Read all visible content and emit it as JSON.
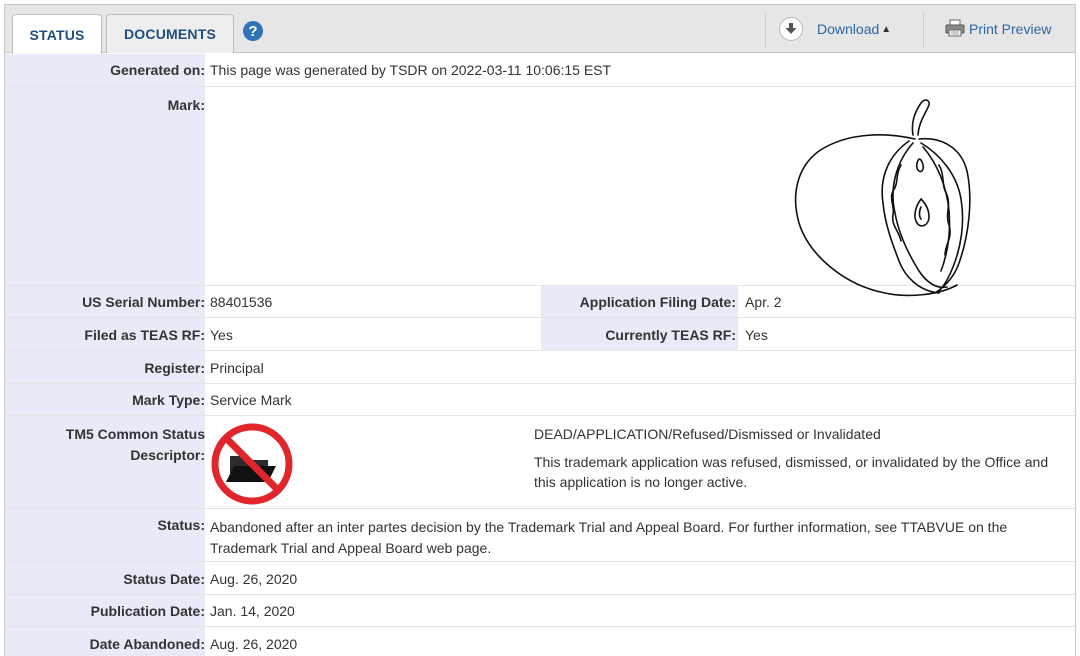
{
  "tabs": [
    {
      "label": "STATUS",
      "active": true
    },
    {
      "label": "DOCUMENTS",
      "active": false
    }
  ],
  "help_icon": "?",
  "toolbar": {
    "download_label": "Download",
    "print_preview_label": "Print Preview"
  },
  "fields": {
    "generated_on": {
      "label": "Generated on:",
      "value": "This page was generated by TSDR on 2022-03-11 10:06:15 EST"
    },
    "mark": {
      "label": "Mark:"
    },
    "serial": {
      "label": "US Serial Number:",
      "value": "88401536"
    },
    "filing_date": {
      "label": "Application Filing Date:",
      "value": "Apr. 2"
    },
    "filed_teas": {
      "label": "Filed as TEAS RF:",
      "value": "Yes"
    },
    "currently_teas": {
      "label": "Currently TEAS RF:",
      "value": "Yes"
    },
    "register": {
      "label": "Register:",
      "value": "Principal"
    },
    "mark_type": {
      "label": "Mark Type:",
      "value": "Service Mark"
    },
    "tm5": {
      "label_line1": "TM5 Common Status",
      "label_line2": "Descriptor:",
      "code": "DEAD/APPLICATION/Refused/Dismissed or Invalidated",
      "description": "This trademark application was refused, dismissed, or invalidated by the Office and this application is no longer active."
    },
    "status": {
      "label": "Status:",
      "value": "Abandoned after an inter partes decision by the Trademark Trial and Appeal Board. For further information, see TTABVUE on the Trademark Trial and Appeal Board web page."
    },
    "status_date": {
      "label": "Status Date:",
      "value": "Aug. 26, 2020"
    },
    "publication_date": {
      "label": "Publication Date:",
      "value": "Jan. 14, 2020"
    },
    "date_abandoned": {
      "label": "Date Abandoned:",
      "value": "Aug. 26, 2020"
    }
  },
  "colors": {
    "label_bg": "#e8ebf7",
    "link": "#2a65a8",
    "tab_text": "#1f4f82",
    "no_entry_red": "#e0262b"
  },
  "icons": [
    "help-icon",
    "download-icon",
    "caret-up-icon",
    "printer-icon",
    "dead-application-folder-icon"
  ]
}
